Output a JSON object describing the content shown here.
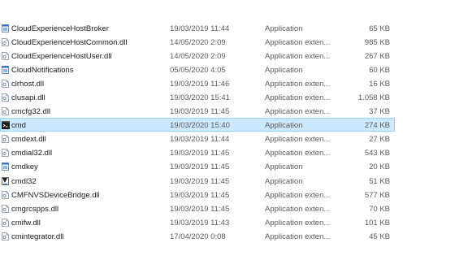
{
  "files": [
    {
      "name": "CloudExperienceHostBroker",
      "date": "19/03/2019 11:44",
      "type": "Application",
      "size": "65 KB",
      "icon": "application-icon"
    },
    {
      "name": "CloudExperienceHostCommon.dll",
      "date": "14/05/2020 2:09",
      "type": "Application exten...",
      "size": "985 KB",
      "icon": "dll-file-icon"
    },
    {
      "name": "CloudExperienceHostUser.dll",
      "date": "14/05/2020 2:09",
      "type": "Application exten...",
      "size": "267 KB",
      "icon": "dll-file-icon"
    },
    {
      "name": "CloudNotifications",
      "date": "05/05/2020 4:05",
      "type": "Application",
      "size": "60 KB",
      "icon": "application-icon"
    },
    {
      "name": "clrhost.dll",
      "date": "19/03/2019 11:46",
      "type": "Application exten...",
      "size": "16 KB",
      "icon": "dll-file-icon"
    },
    {
      "name": "clusapi.dll",
      "date": "19/03/2020 15:41",
      "type": "Application exten...",
      "size": "1.058 KB",
      "icon": "dll-file-icon"
    },
    {
      "name": "cmcfg32.dll",
      "date": "19/03/2019 11:45",
      "type": "Application exten...",
      "size": "37 KB",
      "icon": "dll-file-icon"
    },
    {
      "name": "cmd",
      "date": "19/03/2020 15:40",
      "type": "Application",
      "size": "274 KB",
      "icon": "console-icon",
      "selected": true
    },
    {
      "name": "cmdext.dll",
      "date": "19/03/2019 11:44",
      "type": "Application exten...",
      "size": "27 KB",
      "icon": "dll-file-icon"
    },
    {
      "name": "cmdial32.dll",
      "date": "19/03/2019 11:45",
      "type": "Application exten...",
      "size": "543 KB",
      "icon": "dll-file-icon"
    },
    {
      "name": "cmdkey",
      "date": "19/03/2019 11:45",
      "type": "Application",
      "size": "20 KB",
      "icon": "application-icon"
    },
    {
      "name": "cmdl32",
      "date": "19/03/2019 11:45",
      "type": "Application",
      "size": "51 KB",
      "icon": "download-app-icon"
    },
    {
      "name": "CMFNVSDeviceBridge.dll",
      "date": "19/03/2019 11:45",
      "type": "Application exten...",
      "size": "577 KB",
      "icon": "dll-file-icon"
    },
    {
      "name": "cmgrcspps.dll",
      "date": "19/03/2019 11:45",
      "type": "Application exten...",
      "size": "70 KB",
      "icon": "dll-file-icon"
    },
    {
      "name": "cmifw.dll",
      "date": "19/03/2019 11:43",
      "type": "Application exten...",
      "size": "101 KB",
      "icon": "dll-file-icon"
    },
    {
      "name": "cmintegrator.dll",
      "date": "17/04/2020 0:08",
      "type": "Application exten...",
      "size": "45 KB",
      "icon": "dll-file-icon"
    }
  ],
  "colors": {
    "selection_bg": "#cce8ff",
    "selection_border": "#99d1ff",
    "app_icon_blue": "#2b6cc4"
  }
}
